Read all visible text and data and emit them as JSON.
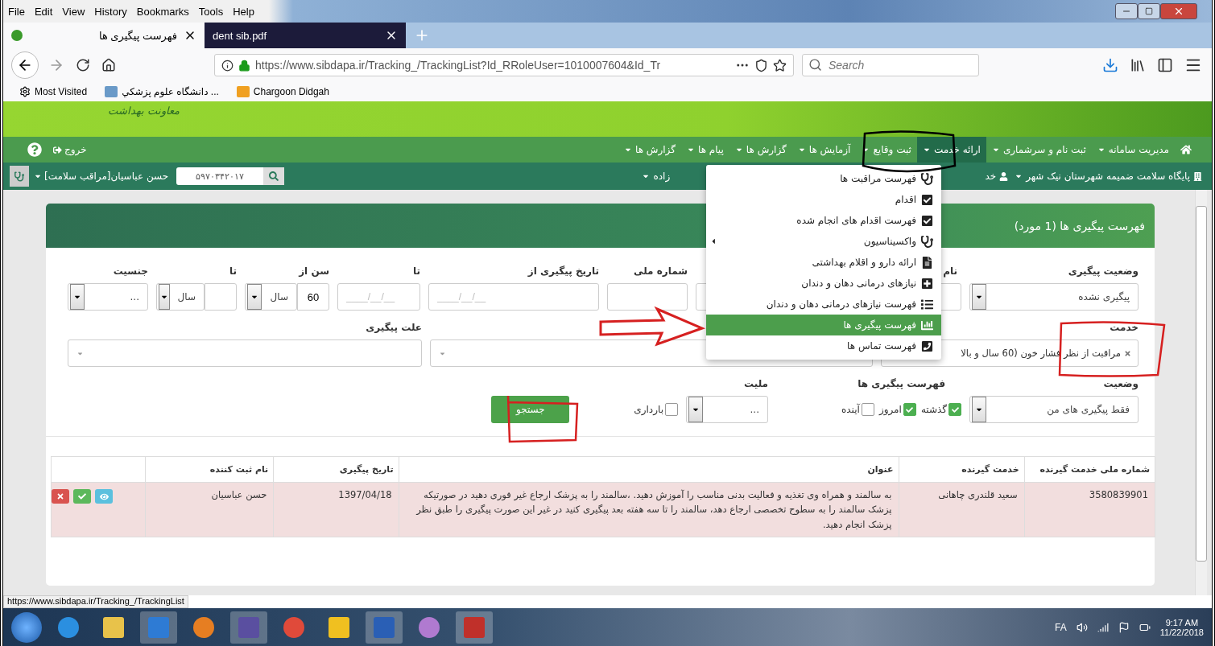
{
  "browser": {
    "menu_bar": [
      "Help",
      "Tools",
      "Bookmarks",
      "History",
      "View",
      "Edit",
      "File"
    ],
    "tabs": [
      {
        "label": "dent sib.pdf",
        "selected": false
      },
      {
        "label": "فهرست پیگیری ها",
        "selected": true
      }
    ],
    "address": "https://www.sibdapa.ir/Tracking_/TrackingList?Id_RRoleUser=1010007604&Id_Tr",
    "search": {
      "placeholder": "Search"
    },
    "bookmarks": [
      "Chargoon Didgah",
      "دانشگاه علوم پزشکي ...",
      "Most Visited"
    ]
  },
  "site": {
    "logo_text": "معاونت بهداشت",
    "nav": [
      {
        "label": "مدیریت سامانه",
        "selected": false
      },
      {
        "label": "ثبت نام و سرشماری",
        "selected": false
      },
      {
        "label": "ارائه خدمت",
        "selected": true
      },
      {
        "label": "ثبت وقایع",
        "selected": false
      },
      {
        "label": "آزمایش ها",
        "selected": false
      },
      {
        "label": "گزارش ها",
        "selected": false
      },
      {
        "label": "پیام ها",
        "selected": false
      },
      {
        "label": "گزارش ها",
        "selected": false
      }
    ],
    "logout": "خروج",
    "location": "پایگاه سلامت ضمیمه شهرستان نیک شهر",
    "role_cut": "خد",
    "name_cut": "زاده",
    "user": "حسن عباسیان[مراقب سلامت]",
    "search_value": "۵۹۷۰۳۴۲۰۱۷"
  },
  "menu": {
    "items": [
      {
        "label": "فهرست مراقبت ها",
        "selected": false,
        "submenu": false
      },
      {
        "label": "اقدام",
        "selected": false,
        "submenu": false
      },
      {
        "label": "فهرست اقدام های انجام شده",
        "selected": false,
        "submenu": false
      },
      {
        "label": "واکسیناسیون",
        "selected": false,
        "submenu": true
      },
      {
        "label": "ارائه دارو و اقلام بهداشتی",
        "selected": false,
        "submenu": false
      },
      {
        "label": "نیازهای درمانی دهان و دندان",
        "selected": false,
        "submenu": false
      },
      {
        "label": "فهرست نیازهای درمانی دهان و دندان",
        "selected": false,
        "submenu": false
      },
      {
        "label": "فهرست پیگیری ها",
        "selected": true,
        "submenu": false
      },
      {
        "label": "فهرست تماس ها",
        "selected": false,
        "submenu": false
      }
    ]
  },
  "card": {
    "title": "فهرست پیگیری ها (1 مورد)"
  },
  "filters": {
    "status_label": "وضعیت پیگیری",
    "status_value": "پیگیری نشده",
    "name_label": "نام",
    "national_id_label": "شماره ملی",
    "date_from_label": "تاریخ پیگیری از",
    "date_from_placeholder": "____/__/__",
    "date_to_label": "تا",
    "date_to_placeholder": "____/__/__",
    "age_from_label": "سن از",
    "age_from_value": "60",
    "age_from_unit": "سال",
    "age_to_label": "تا",
    "age_to_unit": "سال",
    "gender_label": "جنسیت",
    "gender_value": "...",
    "service_label": "خدمت",
    "service_chip": "مراقبت از نظر فشار خون (60 سال و بالا",
    "reason_label": "علت پیگیری",
    "state_label": "وضعیت",
    "state_value": "فقط پیگیری های من",
    "list_label": "فهرست پیگیری ها",
    "periods": [
      {
        "label": "گذشته",
        "checked": true
      },
      {
        "label": "امروز",
        "checked": true
      },
      {
        "label": "آینده",
        "checked": false
      }
    ],
    "nationality_label": "ملیت",
    "nationality_value": "...",
    "pregnancy": {
      "label": "بارداری",
      "checked": false
    },
    "search_button": "جستجو"
  },
  "table": {
    "columns": [
      "شماره ملی خدمت گیرنده",
      "خدمت گیرنده",
      "عنوان",
      "تاریخ پیگیری",
      "نام ثبت کننده"
    ],
    "rows": [
      {
        "cells": [
          "3580839901",
          "سعید قلندری چاهانی",
          "به سالمند و همراه وی تغذیه و فعالیت بدنی مناسب را آموزش دهید. ،سالمند را به پزشک ارجاع غیر فوری دهید در صورتیکه پزشک سالمند را به سطوح تخصصی ارجاع دهد، سالمند را تا سه هفته بعد پیگیری کنید در غیر این صورت پیگیری را طبق نظر پزشک انجام دهید.",
          "1397/04/18",
          "حسن عباسیان"
        ]
      }
    ]
  },
  "status_url": "https://www.sibdapa.ir/Tracking_/TrackingList",
  "taskbar": {
    "language": "FA",
    "time": "9:17 AM",
    "date": "11/22/2018"
  }
}
